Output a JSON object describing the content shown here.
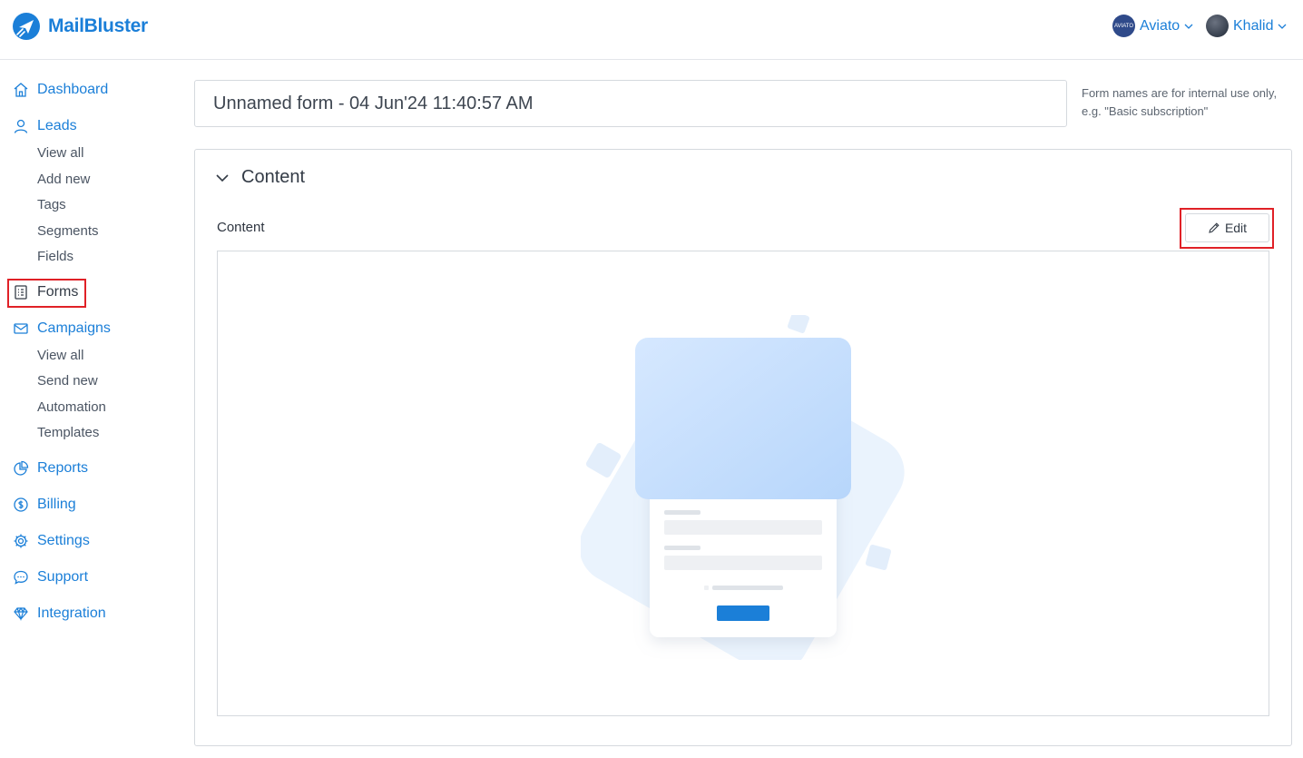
{
  "header": {
    "brand": "MailBluster",
    "accounts": [
      {
        "name": "Aviato",
        "avatar_text": "AVIATO"
      },
      {
        "name": "Khalid"
      }
    ]
  },
  "sidebar": {
    "dashboard": "Dashboard",
    "leads": {
      "label": "Leads",
      "items": [
        "View all",
        "Add new",
        "Tags",
        "Segments",
        "Fields"
      ]
    },
    "forms": "Forms",
    "campaigns": {
      "label": "Campaigns",
      "items": [
        "View all",
        "Send new",
        "Automation",
        "Templates"
      ]
    },
    "reports": "Reports",
    "billing": "Billing",
    "settings": "Settings",
    "support": "Support",
    "integration": "Integration"
  },
  "form": {
    "name": "Unnamed form - 04 Jun'24 11:40:57 AM",
    "hint": "Form names are for internal use only, e.g. \"Basic subscription\""
  },
  "content_panel": {
    "title": "Content",
    "label": "Content",
    "edit_label": "Edit"
  },
  "colors": {
    "accent": "#1b7fd8",
    "highlight": "#e02127",
    "border": "#d5d9de"
  }
}
